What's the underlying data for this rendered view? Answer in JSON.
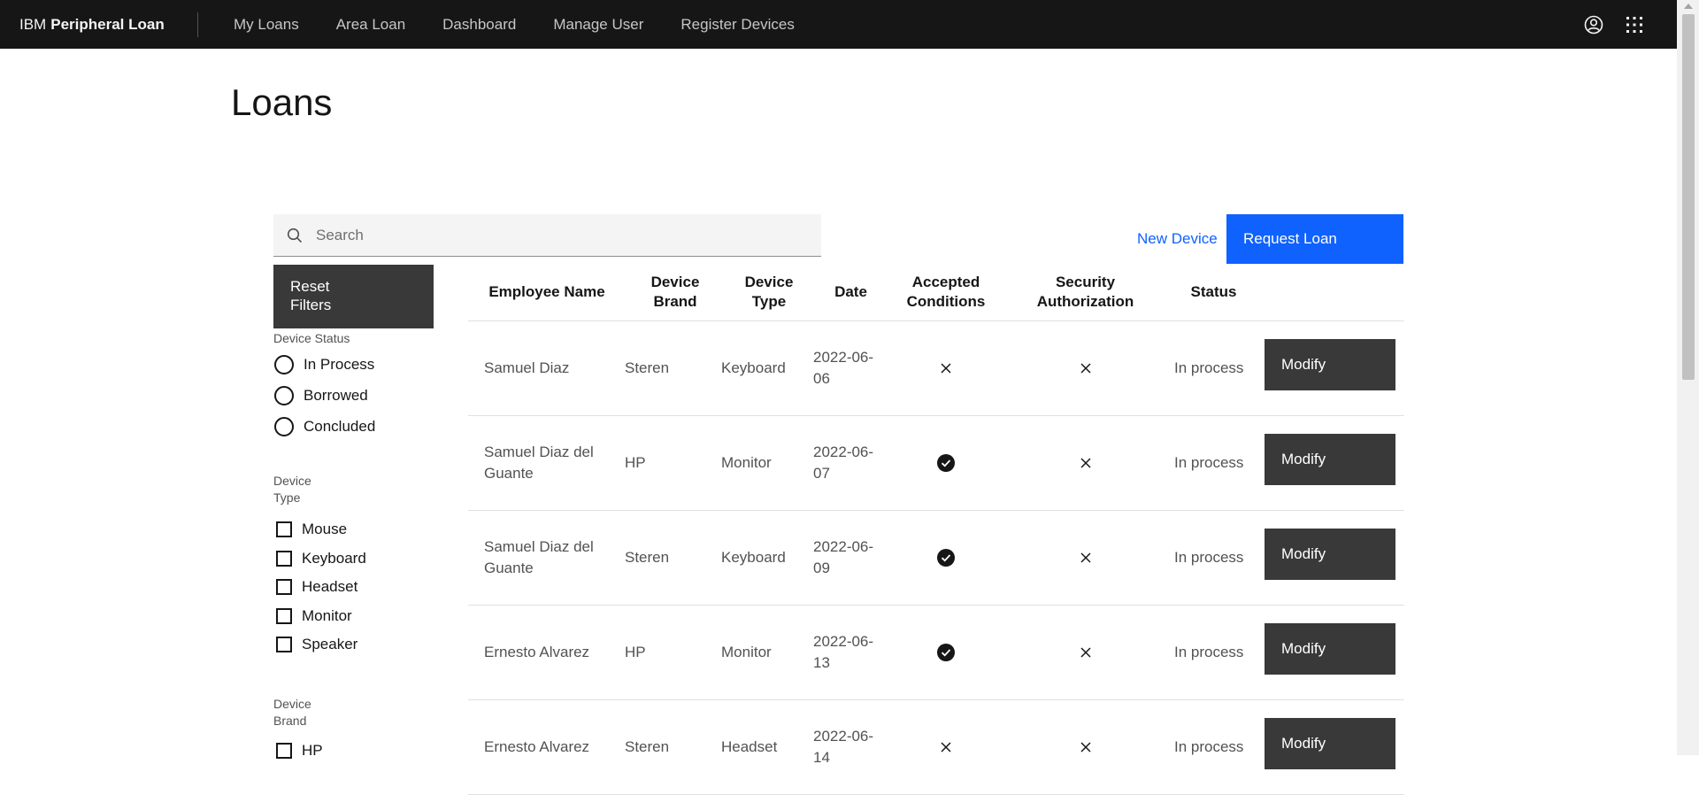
{
  "header": {
    "brand_prefix": "IBM",
    "brand_name": "Peripheral Loan",
    "nav": [
      "My Loans",
      "Area Loan",
      "Dashboard",
      "Manage User",
      "Register Devices"
    ],
    "icons": [
      "user-avatar-icon",
      "app-switcher-icon"
    ]
  },
  "page_title": "Loans",
  "search": {
    "placeholder": "Search",
    "value": ""
  },
  "actions": {
    "new_device": "New Device",
    "request_loan": "Request Loan"
  },
  "filters": {
    "reset_label": "Reset Filters",
    "status": {
      "label": "Device Status",
      "options": [
        "In Process",
        "Borrowed",
        "Concluded"
      ]
    },
    "type": {
      "label": "Device Type",
      "options": [
        "Mouse",
        "Keyboard",
        "Headset",
        "Monitor",
        "Speaker"
      ]
    },
    "brand": {
      "label": "Device Brand",
      "options": [
        "HP"
      ]
    }
  },
  "table": {
    "columns": [
      "Employee Name",
      "Device Brand",
      "Device Type",
      "Date",
      "Accepted Conditions",
      "Security Authorization",
      "Status"
    ],
    "rows": [
      {
        "employee": "Samuel Diaz",
        "brand": "Steren",
        "type": "Keyboard",
        "date": "2022-06-06",
        "accepted": false,
        "security": false,
        "status": "In process",
        "action": "Modify"
      },
      {
        "employee": "Samuel Diaz del Guante",
        "brand": "HP",
        "type": "Monitor",
        "date": "2022-06-07",
        "accepted": true,
        "security": false,
        "status": "In process",
        "action": "Modify"
      },
      {
        "employee": "Samuel Diaz del Guante",
        "brand": "Steren",
        "type": "Keyboard",
        "date": "2022-06-09",
        "accepted": true,
        "security": false,
        "status": "In process",
        "action": "Modify"
      },
      {
        "employee": "Ernesto Alvarez",
        "brand": "HP",
        "type": "Monitor",
        "date": "2022-06-13",
        "accepted": true,
        "security": false,
        "status": "In process",
        "action": "Modify"
      },
      {
        "employee": "Ernesto Alvarez",
        "brand": "Steren",
        "type": "Headset",
        "date": "2022-06-14",
        "accepted": false,
        "security": false,
        "status": "In process",
        "action": "Modify"
      }
    ]
  }
}
